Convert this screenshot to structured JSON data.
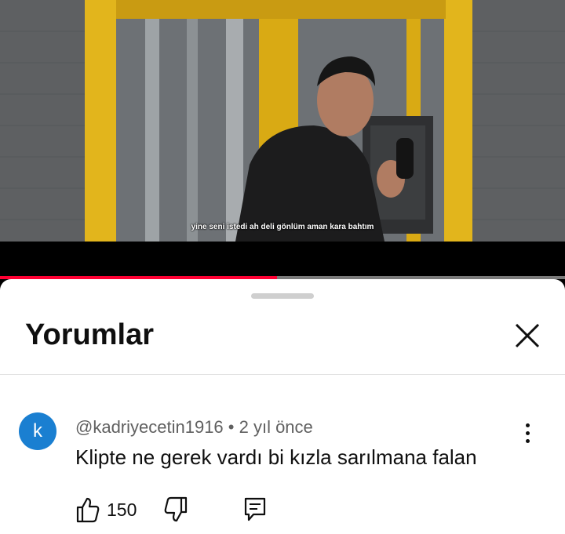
{
  "video": {
    "subtitle": "yine seni istedi ah deli gönlüm aman kara bahtım",
    "progress": 0.49
  },
  "comments_panel": {
    "title": "Yorumlar"
  },
  "comment": {
    "avatar_letter": "k",
    "author": "@kadriyecetin1916",
    "separator": " • ",
    "time": "2 yıl önce",
    "text": "Klipte ne gerek vardı bi kızla sarılmana falan",
    "likes": "150"
  },
  "colors": {
    "progress": "#ff0033",
    "avatar": "#1a7fd1",
    "booth_frame": "#e2b51c"
  },
  "icons": [
    "close-icon",
    "more-vert-icon",
    "thumb-up-icon",
    "thumb-down-icon",
    "reply-icon"
  ]
}
